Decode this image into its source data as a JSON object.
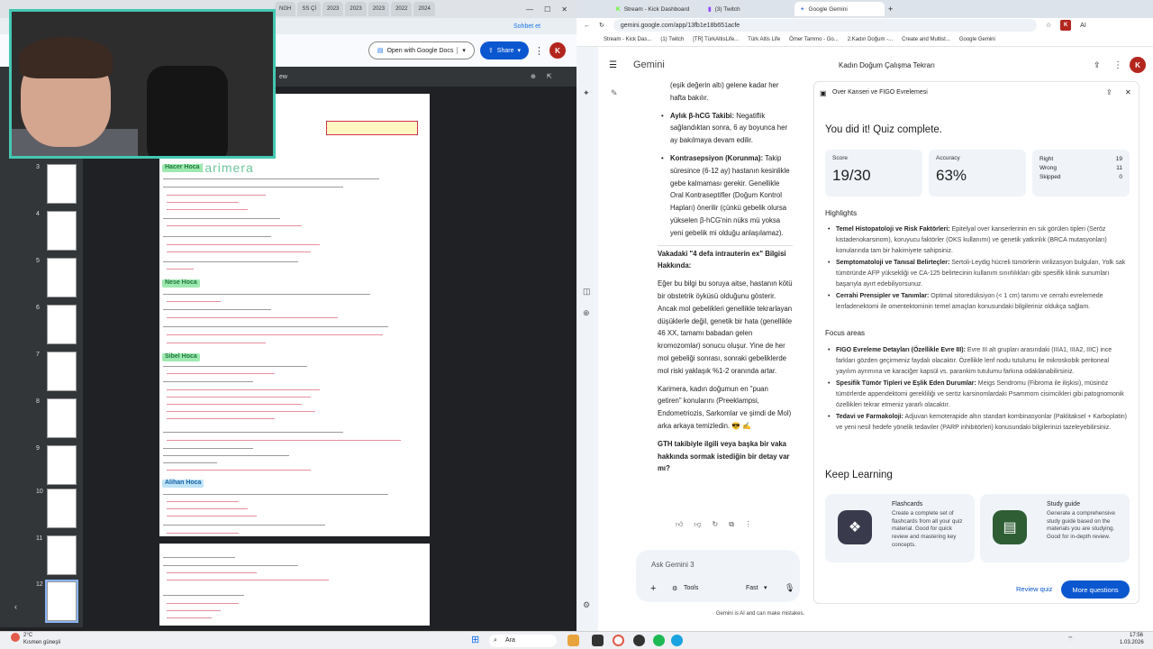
{
  "left_window": {
    "tabs": [
      "NGH",
      "SS Çİ",
      "2023",
      "2023",
      "2023",
      "2022",
      "2024"
    ],
    "view_label": "ew",
    "open_docs_label": "Open with Google Docs",
    "share_label": "Share",
    "avatar_letter": "K",
    "profile_label": "Sohbet et",
    "thumb_numbers": [
      "3",
      "4",
      "5",
      "6",
      "7",
      "8",
      "9",
      "10",
      "11",
      "12"
    ],
    "doc_headings": [
      "Hacer Hoca",
      "Nese Hoca",
      "Sibel Hoca",
      "Alihan Hoca"
    ],
    "doc_title": "Karimera"
  },
  "right_window": {
    "tabs": [
      {
        "label": "Stream - Kick Dashboard",
        "icon": "kick-icon"
      },
      {
        "label": "(3) Twitch",
        "icon": "twitch-icon"
      },
      {
        "label": "Google Gemini",
        "icon": "gemini-icon"
      }
    ],
    "url": "gemini.google.com/app/13fb1e18b651acfe",
    "ai_label": "AI",
    "bookmarks": [
      "Stream - Kick Das...",
      "(1) Twitch",
      "[TR] TürkAltisLife...",
      "Türk Altis Life",
      "Ömer Tammo - Go...",
      "2.Kadın Doğum -...",
      "Create and Multist...",
      "Google Gemini"
    ],
    "app_name": "Gemini",
    "conversation_title": "Kadın Doğum Çalışma Tekrarı",
    "chat": {
      "intro": "(eşik değerin altı) gelene kadar her hafta bakılır.",
      "items": [
        {
          "bold": "Aylık β-hCG Takibi:",
          "text": " Negatiflik sağlandıktan sonra, 6 ay boyunca her ay bakılmaya devam edilir."
        },
        {
          "bold": "Kontrasepsiyon (Korunma):",
          "text": " Takip süresince (6-12 ay) hastanın kesinlikle gebe kalmaması gerekir. Genellikle Oral Kontraseptifler (Doğum Kontrol Hapları) önerilir (çünkü gebelik olursa yükselen β-hCG'nin nüks mü yoksa yeni gebelik mi olduğu anlaşılamaz)."
        }
      ],
      "heading": "Vakadaki \"4 defa intrauterin ex\" Bilgisi Hakkında:",
      "para1": "Eğer bu bilgi bu soruya aitse, hastanın kötü bir obstetrik öyküsü olduğunu gösterir. Ancak mol gebelikleri genellikle tekrarlayan düşüklerle değil, genetik bir hata (genellikle 46 XX, tamamı babadan gelen kromozomlar) sonucu oluşur. Yine de her mol gebeliği sonrası, sonraki gebeliklerde mol riski yaklaşık %1-2 oranında artar.",
      "para2": "Karimera, kadın doğumun en \"puan getiren\" konularını (Preeklampsi, Endometriozis, Sarkomlar ve şimdi de Mol) arka arkaya temizledin. 😎 ✍",
      "question": "GTH takibiyle ilgili veya başka bir vaka hakkında sormak istediğin bir detay var mı?"
    },
    "input_placeholder": "Ask Gemini 3",
    "tools_label": "Tools",
    "mode_label": "Fast",
    "disclaimer": "Gemini is AI and can make mistakes.",
    "quiz": {
      "title": "Over Kanseri ve FIGO Evrelemesi",
      "complete": "You did it! Quiz complete.",
      "score_label": "Score",
      "score": "19/30",
      "accuracy_label": "Accuracy",
      "accuracy": "63%",
      "right_label": "Right",
      "right": "19",
      "wrong_label": "Wrong",
      "wrong": "11",
      "skipped_label": "Skipped",
      "skipped": "0",
      "highlights_title": "Highlights",
      "highlights": [
        {
          "bold": "Temel Histopatoloji ve Risk Faktörleri:",
          "text": " Epitelyal over kanserlerinin en sık görülen tipleri (Seröz kistadenokarsinom), koruyucu faktörler (OKS kullanımı) ve genetik yatkınlık (BRCA mutasyonları) konularında tam bir hakimiyete sahipsiniz."
        },
        {
          "bold": "Semptomatoloji ve Tanısal Belirteçler:",
          "text": " Sertoli-Leydig hücreli tümörlerin virilizasyon bulguları, Yolk sak tümöründe AFP yüksekliği ve CA-125 belirtecinin kullanım sınırlılıkları gibi spesifik klinik sunumları başarıyla ayırt edebiliyorsunuz."
        },
        {
          "bold": "Cerrahi Prensipler ve Tanımlar:",
          "text": " Optimal sitoredüksiyon (< 1 cm) tanımı ve cerrahi evrelemede lenfadenektomi ile omentektominin temel amaçları konusundaki bilgileriniz oldukça sağlam."
        }
      ],
      "focus_title": "Focus areas",
      "focus": [
        {
          "bold": "FIGO Evreleme Detayları (Özellikle Evre III):",
          "text": " Evre III alt grupları arasındaki (IIIA1, IIIA2, IIIC) ince farkları gözden geçirmeniz faydalı olacaktır. Özellikle lenf nodu tutulumu ile mikroskobik peritoneal yayılım ayrımına ve karaciğer kapsül vs. parankim tutulumu farkına odaklanabilirsiniz."
        },
        {
          "bold": "Spesifik Tümör Tipleri ve Eşlik Eden Durumlar:",
          "text": " Meigs Sendromu (Fibroma ile ilişkisi), müsinöz tümörlerde appendektomi gerekliliği ve seröz karsinomlardaki Psammom cisimcikleri gibi patognomonik özellikleri tekrar etmeniz yararlı olacaktır."
        },
        {
          "bold": "Tedavi ve Farmakoloji:",
          "text": " Adjuvan kemoterapide altın standart kombinasyonlar (Paklitaksel + Karboplatin) ve yeni nesil hedefe yönelik tedaviler (PARP inhibitörleri) konusundaki bilgilerinizi tazeleyebilirsiniz."
        }
      ],
      "keep_learning": "Keep Learning",
      "cards": [
        {
          "title": "Flashcards",
          "desc": "Create a complete set of flashcards from all your quiz material. Good for quick review and mastering key concepts.",
          "color": "#3a3a4d",
          "icon": "flashcards-icon"
        },
        {
          "title": "Study guide",
          "desc": "Generate a comprehensive study guide based on the materials you are studying. Good for in-depth review.",
          "color": "#2f5e35",
          "icon": "study-guide-icon"
        }
      ],
      "review_label": "Review quiz",
      "more_label": "More questions"
    }
  },
  "taskbar": {
    "weather_temp": "2°C",
    "weather_desc": "Kısmen güneşli",
    "search_label": "Ara",
    "time": "17:56",
    "date": "1.03.2026"
  }
}
